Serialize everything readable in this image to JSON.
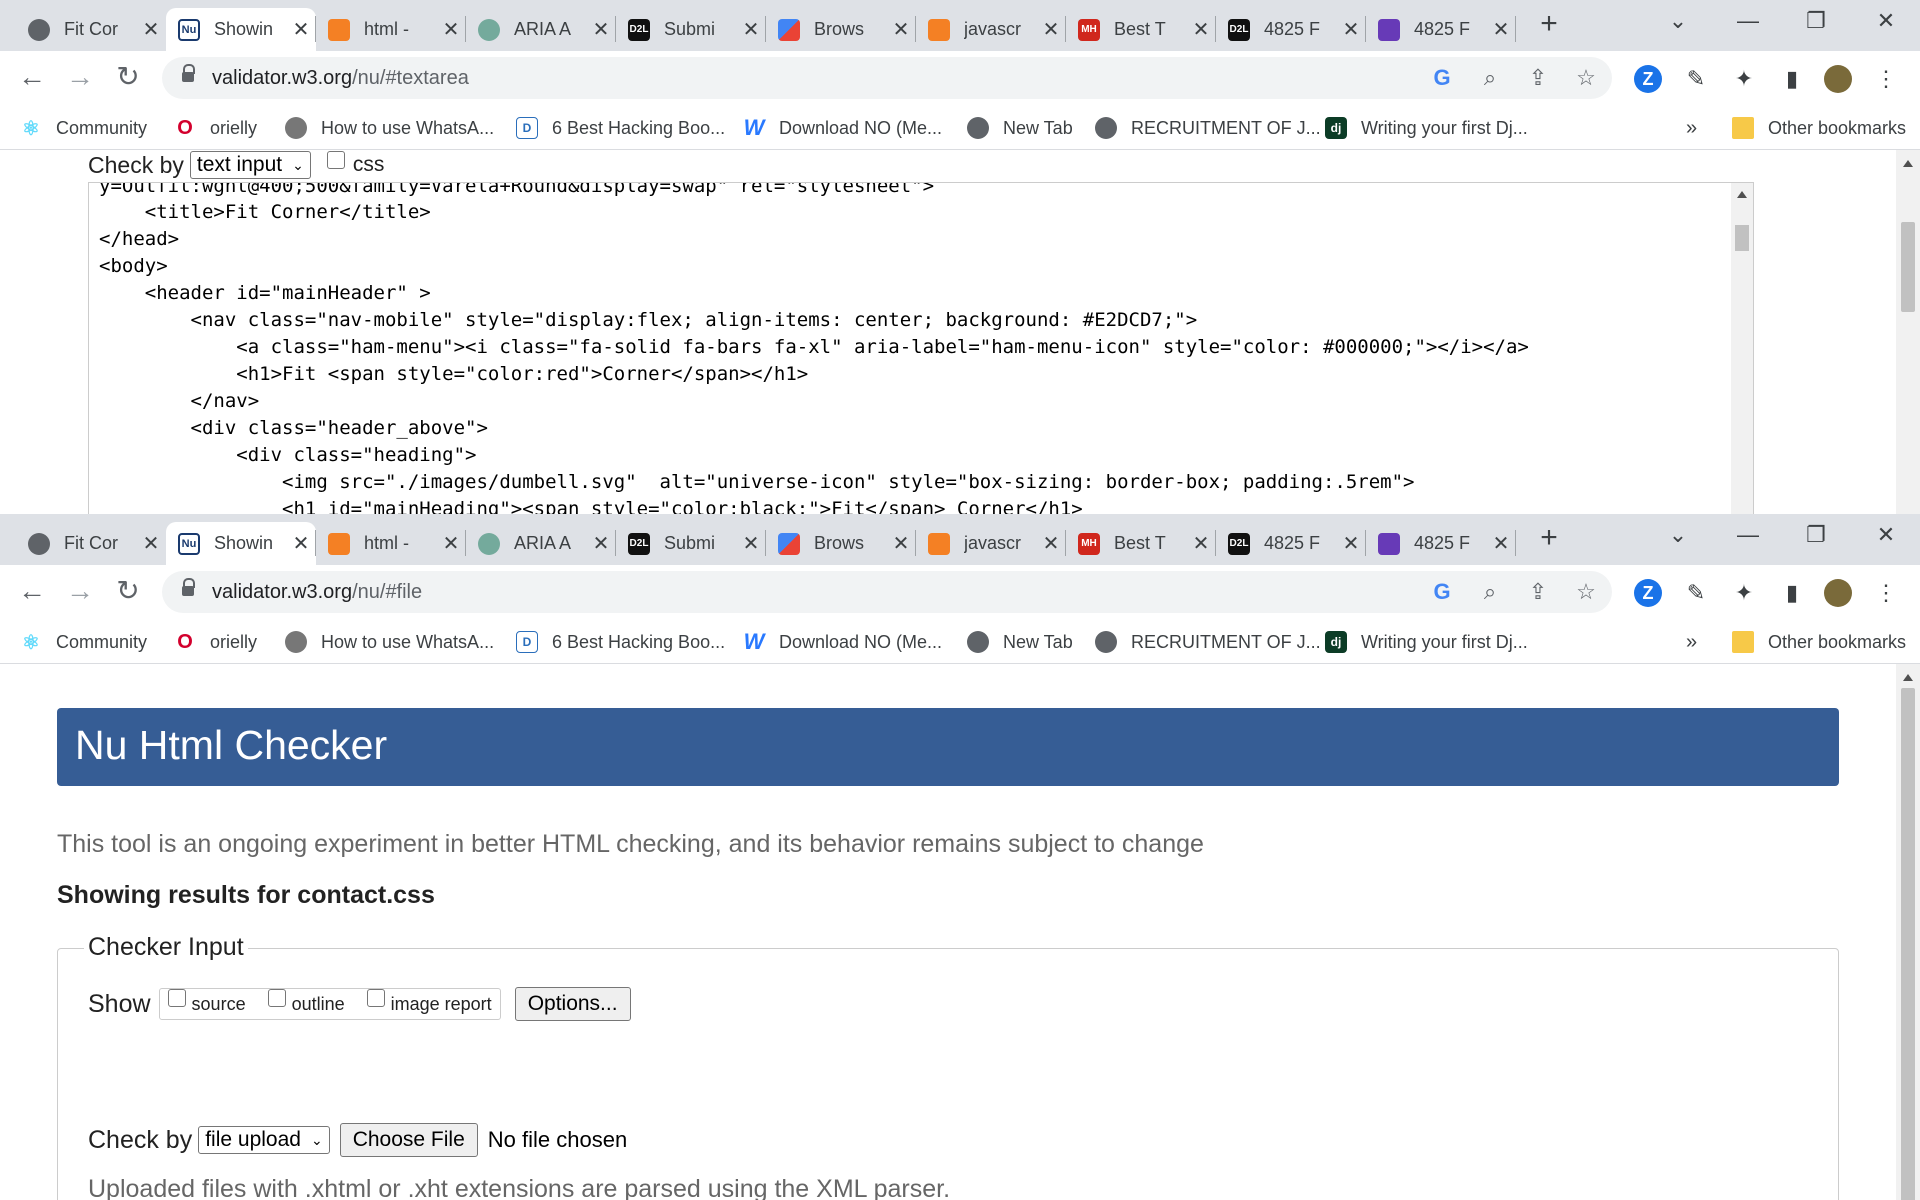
{
  "tabs": [
    {
      "title": "Fit Cor",
      "favicon": "globe-icon",
      "active": false
    },
    {
      "title": "Showin",
      "favicon": "w3c-nu-icon",
      "active": true
    },
    {
      "title": "html -",
      "favicon": "stackoverflow-icon",
      "active": false
    },
    {
      "title": "ARIA A",
      "favicon": "openai-icon",
      "active": false
    },
    {
      "title": "Submi",
      "favicon": "d2l-icon",
      "active": false
    },
    {
      "title": "Brows",
      "favicon": "puzzle-brand-icon",
      "active": false
    },
    {
      "title": "javascr",
      "favicon": "stackoverflow-icon",
      "active": false
    },
    {
      "title": "Best T",
      "favicon": "mh-icon",
      "active": false
    },
    {
      "title": "4825 F",
      "favicon": "d2l-icon",
      "active": false
    },
    {
      "title": "4825 F",
      "favicon": "forms-icon",
      "active": false
    }
  ],
  "favicon_text": {
    "d2l": "D2L",
    "mh": "MH",
    "dj": "dj",
    "w": "W",
    "d": "D"
  },
  "glyphs": {
    "close": "✕",
    "new_tab": "+",
    "minimize": "—",
    "restore": "❐",
    "chevron": "⌄",
    "back": "←",
    "forward": "→",
    "reload": "↻",
    "more": "»",
    "caret": "⌄"
  },
  "top_window": {
    "url_host": "validator.w3.org",
    "url_path": "/nu/#textarea",
    "check_by_label": "Check by",
    "check_by_value": "text input",
    "css_label": "css",
    "code_lines": [
      "y=Outfit:wght@400;500&family=Varela+Round&display=swap\" rel=\"stylesheet\">",
      "    <title>Fit Corner</title>",
      "</head>",
      "<body>",
      "    <header id=\"mainHeader\" >",
      "        <nav class=\"nav-mobile\" style=\"display:flex; align-items: center; background: #E2DCD7;\">",
      "            <a class=\"ham-menu\"><i class=\"fa-solid fa-bars fa-xl\" aria-label=\"ham-menu-icon\" style=\"color: #000000;\"></i></a>",
      "            <h1>Fit <span style=\"color:red\">Corner</span></h1>",
      "        </nav>",
      "        <div class=\"header_above\">",
      "            <div class=\"heading\">",
      "                <img src=\"./images/dumbell.svg\"  alt=\"universe-icon\" style=\"box-sizing: border-box; padding:.5rem\">",
      "                <h1 id=\"mainHeading\"><span style=\"color:black;\">Fit</span> Corner</h1>"
    ]
  },
  "bottom_window": {
    "url_host": "validator.w3.org",
    "url_path": "/nu/#file",
    "banner_title": "Nu Html Checker",
    "tagline": "This tool is an ongoing experiment in better HTML checking, and its behavior remains subject to change",
    "results_heading": "Showing results for contact.css",
    "legend": "Checker Input",
    "show_label": "Show",
    "show_options": [
      "source",
      "outline",
      "image report"
    ],
    "options_button": "Options...",
    "check_by_label": "Check by",
    "check_by_value": "file upload",
    "choose_file_button": "Choose File",
    "no_file_text": "No file chosen",
    "xml_note": "Uploaded files with .xhtml or .xht extensions are parsed using the XML parser."
  },
  "bookmarks": [
    {
      "label": "Community",
      "icon": "react-icon"
    },
    {
      "label": "orielly",
      "icon": "oreilly-icon"
    },
    {
      "label": "How to use WhatsA...",
      "icon": "bug-icon"
    },
    {
      "label": "6 Best Hacking Boo...",
      "icon": "d-icon"
    },
    {
      "label": "Download NO (Me...",
      "icon": "w-icon"
    },
    {
      "label": "New Tab",
      "icon": "globe-icon"
    },
    {
      "label": "RECRUITMENT OF J...",
      "icon": "globe-icon"
    },
    {
      "label": "Writing your first Dj...",
      "icon": "django-icon"
    }
  ],
  "bookmarks_more": "»",
  "other_bookmarks": "Other bookmarks",
  "colors": {
    "banner": "#365d95",
    "tabstrip": "#dee1e6",
    "omnibox": "#f1f3f4",
    "zoom_badge": "#1a73e8"
  }
}
